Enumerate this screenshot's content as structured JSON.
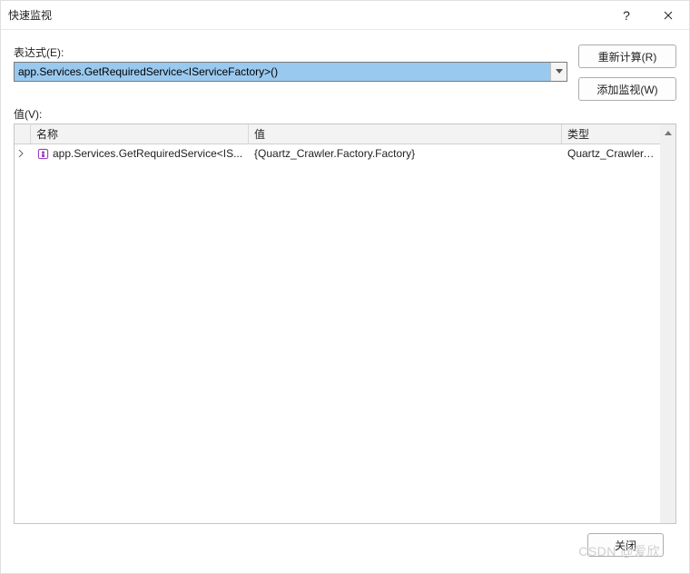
{
  "window": {
    "title": "快速监视"
  },
  "labels": {
    "expression": "表达式(E):",
    "value": "值(V):"
  },
  "expression": {
    "text": "app.Services.GetRequiredService<IServiceFactory>()"
  },
  "buttons": {
    "recalculate": "重新计算(R)",
    "addWatch": "添加监视(W)",
    "close": "关闭"
  },
  "grid": {
    "columns": {
      "name": "名称",
      "value": "值",
      "type": "类型"
    },
    "rows": [
      {
        "name": "app.Services.GetRequiredService<IS...",
        "value": "{Quartz_Crawler.Factory.Factory}",
        "type": "Quartz_Crawler.Ser..."
      }
    ]
  },
  "watermark": "CSDN @爱欣"
}
